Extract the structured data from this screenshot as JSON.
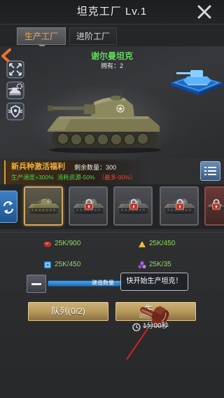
{
  "header": {
    "title": "坦克工厂 Lv.1"
  },
  "tabs": [
    {
      "label": "生产工厂",
      "active": true
    },
    {
      "label": "进阶工厂",
      "active": false
    }
  ],
  "tank": {
    "name": "谢尔曼坦克",
    "owned": "拥有：2"
  },
  "bonus": {
    "title": "新兵种激活福利",
    "remaining": "剩余数量：300",
    "speed": "生产速度+300%",
    "cost": "消耗资源-50%",
    "cap": "（最多-90%）"
  },
  "slots": [
    {
      "selected": true,
      "locked": false
    },
    {
      "selected": false,
      "locked": true
    },
    {
      "selected": false,
      "locked": true
    },
    {
      "selected": false,
      "locked": true
    },
    {
      "selected": false,
      "locked": true
    }
  ],
  "resources": [
    {
      "icon": "meat-icon",
      "value": "25K/900"
    },
    {
      "icon": "gold-pile-icon",
      "value": "25K/450"
    },
    {
      "icon": "chip-icon",
      "value": "25K/450"
    },
    {
      "icon": "gem-cluster-icon",
      "value": "25K/35"
    }
  ],
  "quantity": {
    "label": "建造数量"
  },
  "tooltip": {
    "text": "快开始生产坦克！"
  },
  "buttons": {
    "queue": "队列(0/2)",
    "produce": "生",
    "produce_sub": "00分00"
  },
  "timer": {
    "value": "1分00秒"
  },
  "colors": {
    "tank_name": "#62d85c",
    "tab_active_text": "#f2a941",
    "bonus_title": "#f2b13c",
    "bonus_positive": "#4fd14a",
    "bonus_cap": "#e5463a",
    "resource_text": "#8fdb62",
    "slider": "#1f6fb8",
    "button_gold": "#b39658"
  }
}
